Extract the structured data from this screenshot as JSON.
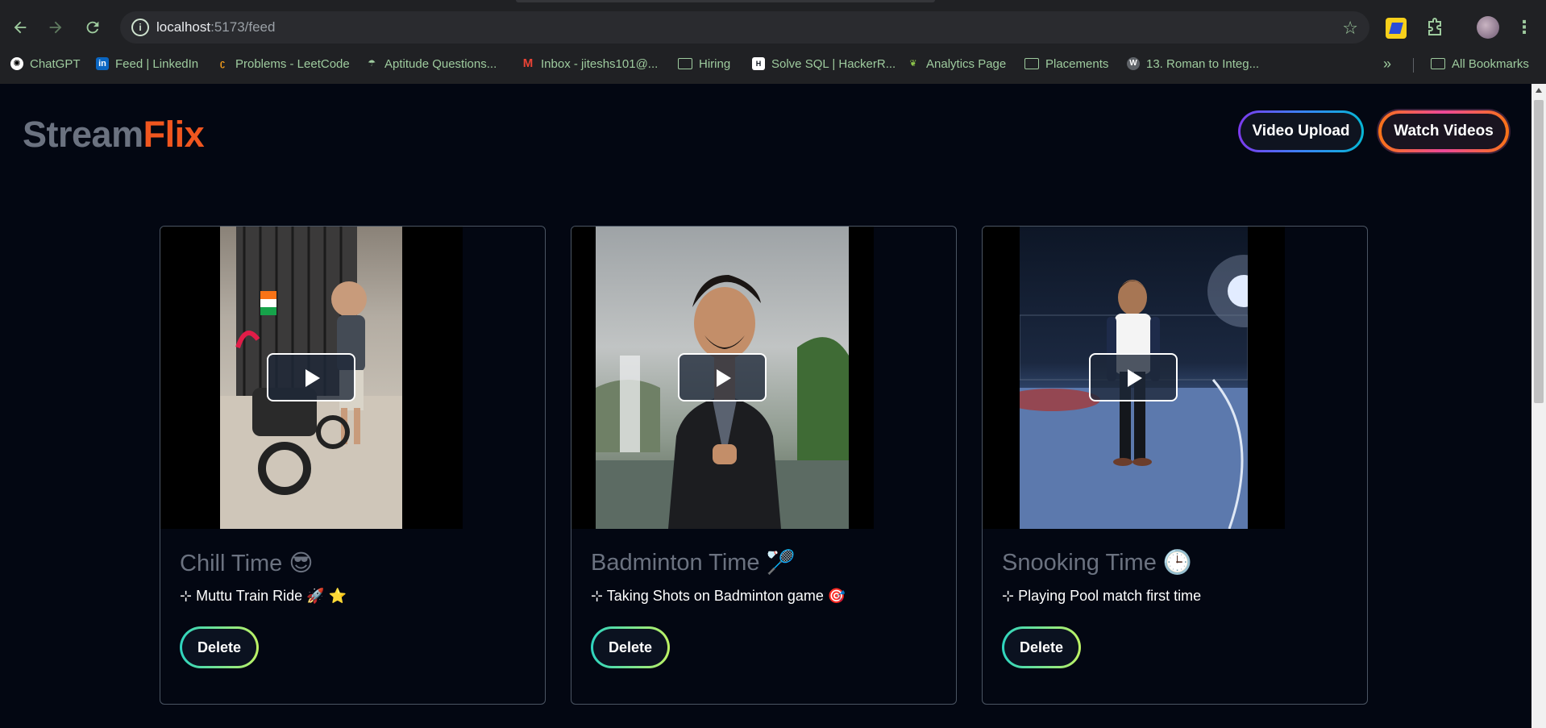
{
  "browser": {
    "url_host": "localhost",
    "url_path": ":5173/feed",
    "bookmarks": [
      {
        "label": "ChatGPT",
        "icon": "chatgpt-icon"
      },
      {
        "label": "Feed | LinkedIn",
        "icon": "linkedin-icon"
      },
      {
        "label": "Problems - LeetCode",
        "icon": "leetcode-icon"
      },
      {
        "label": "Aptitude Questions...",
        "icon": "aptitude-icon"
      },
      {
        "label": "Inbox - jiteshs101@...",
        "icon": "gmail-icon"
      },
      {
        "label": "Hiring",
        "icon": "folder-icon"
      },
      {
        "label": "Solve SQL | HackerR...",
        "icon": "hackerrank-icon"
      },
      {
        "label": "Analytics Page",
        "icon": "leaf-icon"
      },
      {
        "label": "Placements",
        "icon": "folder-icon"
      },
      {
        "label": "13. Roman to Integ...",
        "icon": "w-icon"
      }
    ],
    "overflow_label": "»",
    "all_bookmarks_label": "All Bookmarks"
  },
  "app": {
    "logo_part1": "Stream",
    "logo_part2": "Flix",
    "upload_label": "Video Upload",
    "watch_label": "Watch Videos"
  },
  "videos": [
    {
      "title": "Chill Time 😎",
      "description": "⊹ Muttu Train Ride 🚀 ⭐",
      "delete_label": "Delete"
    },
    {
      "title": "Badminton Time 🏸",
      "description": "⊹ Taking Shots on Badminton game 🎯",
      "delete_label": "Delete"
    },
    {
      "title": "Snooking Time 🕒",
      "description": "⊹ Playing Pool match first time",
      "delete_label": "Delete"
    }
  ],
  "colors": {
    "page_bg": "#030712",
    "logo_gray": "#6b7280",
    "logo_orange": "#f0561f",
    "bookmark_text": "#9ecb9e"
  }
}
